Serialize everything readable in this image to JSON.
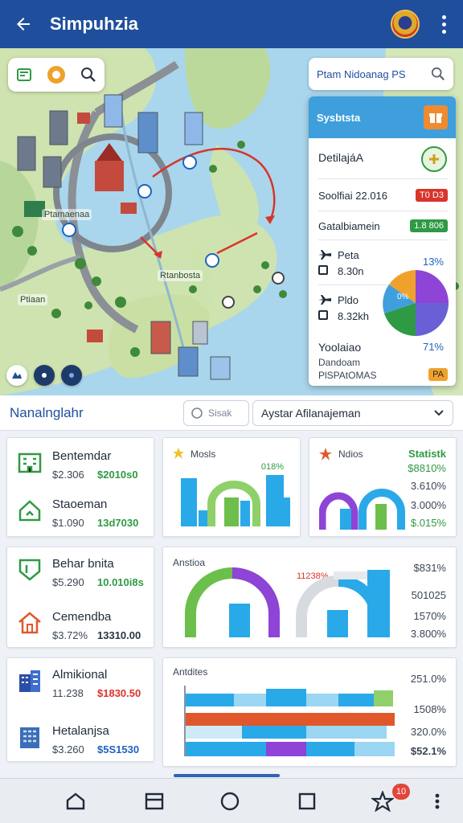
{
  "appbar": {
    "title": "Simpuhzia"
  },
  "map": {
    "search_placeholder": "Ptam Nidoanag PS",
    "labels": [
      "Ptamaenaa",
      "Rtanbosta",
      "Ptiaan"
    ]
  },
  "info_panel": {
    "header": "Sysbtsta",
    "name": "DetilajáA",
    "row1_label": "Soolfiai 22.016",
    "row1_badge": "T0 D3",
    "row2_label": "Gatalbiamein",
    "row2_badge": "1.8 806",
    "flights": [
      {
        "label": "Peta",
        "value": "8.30n"
      },
      {
        "label": "Pldo",
        "value": "8.32kh"
      }
    ],
    "pct_1": "13%",
    "pct_2": "71%",
    "pie_label": "0%",
    "footer_title": "Yoolaiao",
    "footer_sub1": "Dandoam",
    "footer_sub2": "PlSPAtOMAS",
    "footer_badge": "PA"
  },
  "section": {
    "title": "Nanalnglahr",
    "search_placeholder": "Sisak",
    "select_value": "Aystar Afilanajeman"
  },
  "stats_card1": [
    {
      "name": "Bentemdar",
      "v1": "$2.306",
      "v2": "$2010s0",
      "color": "green"
    },
    {
      "name": "Staoeman",
      "v1": "$1.090",
      "v2": "13d7030",
      "color": "green"
    }
  ],
  "stats_card2": [
    {
      "name": "Behar bnita",
      "v1": "$5.290",
      "v2": "10.010i8s",
      "color": "green"
    },
    {
      "name": "Cemendba",
      "v1": "$3.72%",
      "v2": "13310.00",
      "color": "green"
    }
  ],
  "stats_card3": [
    {
      "name": "Almikional",
      "v1": "11.238",
      "v2": "$1830.50",
      "color": "red"
    },
    {
      "name": "Hetalanjsa",
      "v1": "$3.260",
      "v2": "$5S1530",
      "color": "blue"
    }
  ],
  "chart_card_a": {
    "title": "Mosls",
    "value": "018%"
  },
  "chart_card_b": {
    "title": "Ndios",
    "heading": "Statistk",
    "values": [
      "$8810%",
      "3.610%",
      "3.000%",
      "$.015%"
    ]
  },
  "chart_card_c": {
    "title": "Anstioa",
    "value": "11238%"
  },
  "chart_card_c_pcts": [
    "$831%",
    "501025",
    "1570%",
    "3.800%"
  ],
  "chart_card_d": {
    "title": "Antdites"
  },
  "chart_card_d_pcts": [
    "251.0%",
    "1508%",
    "320.0%",
    "$52.1%"
  ],
  "bottom_nav": {
    "badge": "10"
  },
  "colors": {
    "primary": "#1f4f9c",
    "accent_blue": "#3e9fdc",
    "green": "#2f9a44",
    "red": "#d8342b",
    "purple": "#8e44d6"
  }
}
